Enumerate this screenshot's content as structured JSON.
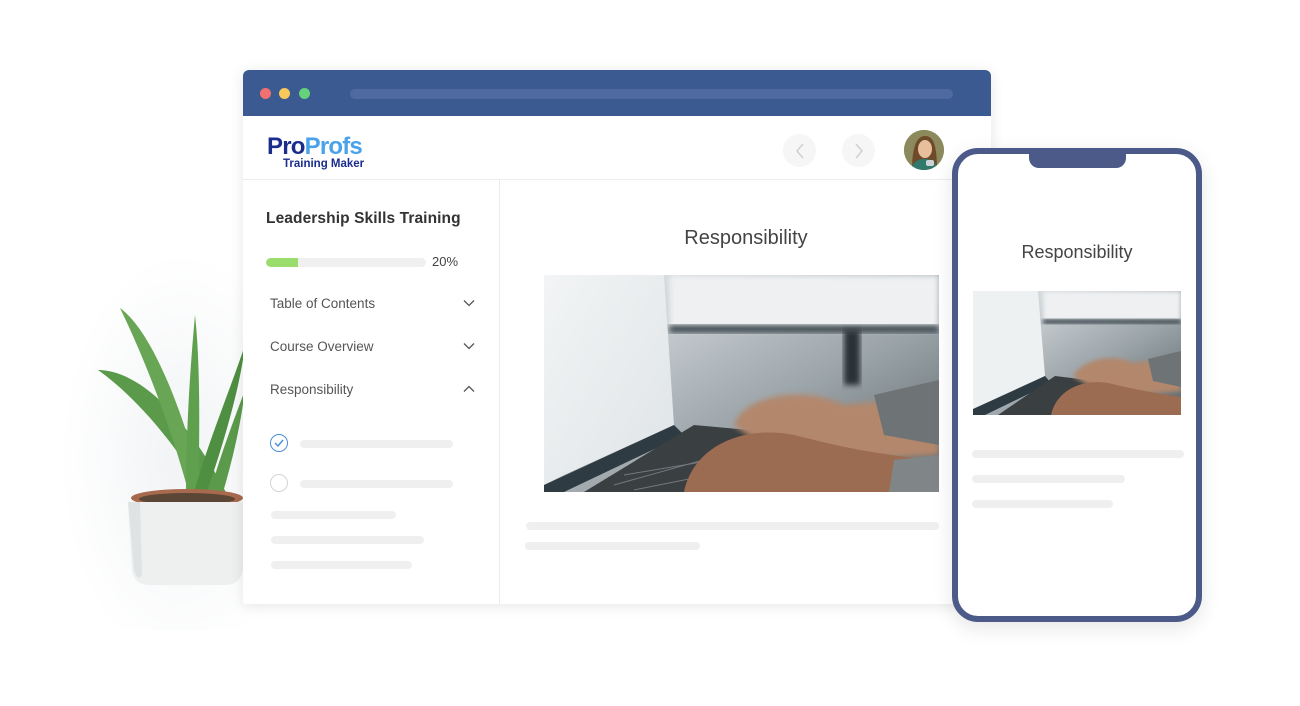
{
  "browser": {
    "window_controls": [
      "close",
      "minimize",
      "maximize"
    ],
    "colors": {
      "titlebar": "#3c5a92",
      "close": "#f2706f",
      "minimize": "#f9c85a",
      "maximize": "#66d17b"
    }
  },
  "app": {
    "logo": {
      "brand_part1": "Pro",
      "brand_part2": "Profs",
      "product": "Training Maker"
    },
    "nav": {
      "prev_icon": "chevron-left-icon",
      "next_icon": "chevron-right-icon",
      "prev_glyph": "‹",
      "next_glyph": "›"
    },
    "avatar": "user-avatar"
  },
  "sidebar": {
    "course_title": "Leadership Skills Training",
    "progress": {
      "percent": 20,
      "label": "20%",
      "color": "#9bdd6c"
    },
    "menu": [
      {
        "label": "Table of Contents",
        "state": "collapsed",
        "icon": "chevron-down-icon"
      },
      {
        "label": "Course Overview",
        "state": "collapsed",
        "icon": "chevron-down-icon"
      },
      {
        "label": "Responsibility",
        "state": "expanded",
        "icon": "chevron-up-icon"
      }
    ],
    "lessons": [
      {
        "status": "completed",
        "icon": "check-circle-icon"
      },
      {
        "status": "not-started",
        "icon": "empty-circle-icon"
      }
    ]
  },
  "content": {
    "title": "Responsibility",
    "image": "laptop-typing-photo"
  },
  "phone": {
    "title": "Responsibility",
    "image": "laptop-typing-photo",
    "frame_color": "#4b5a88"
  },
  "decor": {
    "plant": "aloe-plant-in-white-pot"
  }
}
